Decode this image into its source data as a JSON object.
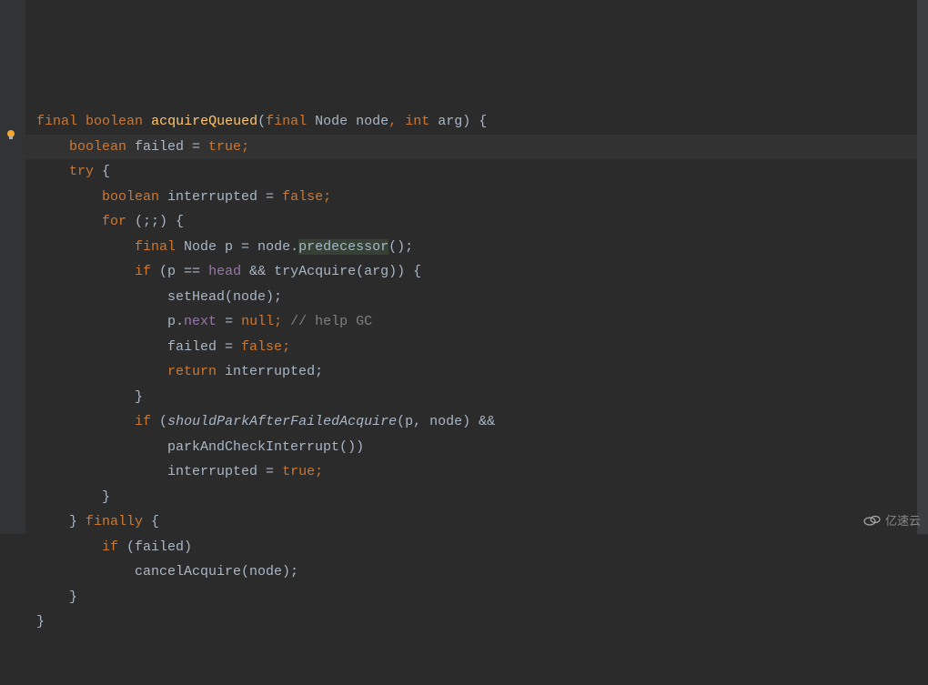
{
  "code": {
    "line1": {
      "kw_final": "final",
      "kw_boolean": "boolean",
      "method": "acquireQueued",
      "paren_open": "(",
      "kw_final2": "final",
      "type_node": "Node",
      "param_node": "node",
      "comma": ", ",
      "kw_int": "int",
      "param_arg": " arg",
      "paren_close": ") {"
    },
    "line2": {
      "kw_boolean": "boolean",
      "var": " failed = ",
      "kw_true": "true",
      "semi": ";"
    },
    "line3": {
      "kw_try": "try",
      "brace": " {"
    },
    "line4": {
      "kw_boolean": "boolean",
      "var": " interrupted = ",
      "kw_false": "false",
      "semi": ";"
    },
    "line5": {
      "kw_for": "for",
      "parens": " (;;) {"
    },
    "line6": {
      "kw_final": "final",
      "type": " Node p = node.",
      "predecessor": "predecessor",
      "end": "();"
    },
    "line7": {
      "kw_if": "if",
      "open": " (p == ",
      "head": "head",
      "and": " && tryAcquire(arg)) {"
    },
    "line8": {
      "text": "setHead(node);"
    },
    "line9": {
      "p_dot": "p.",
      "next": "next",
      "eq": " = ",
      "kw_null": "null",
      "semi": "; ",
      "comment": "// help GC"
    },
    "line10": {
      "var": "failed = ",
      "kw_false": "false",
      "semi": ";"
    },
    "line11": {
      "kw_return": "return",
      "var": " interrupted;"
    },
    "line12": {
      "brace": "}"
    },
    "line13": {
      "kw_if": "if",
      "open": " (",
      "method": "shouldParkAfterFailedAcquire",
      "args": "(p, node) &&"
    },
    "line14": {
      "text": "parkAndCheckInterrupt())"
    },
    "line15": {
      "var": "interrupted = ",
      "kw_true": "true",
      "semi": ";"
    },
    "line16": {
      "brace": "}"
    },
    "line17": {
      "brace": "} ",
      "kw_finally": "finally",
      "open": " {"
    },
    "line18": {
      "kw_if": "if",
      "cond": " (failed)"
    },
    "line19": {
      "text": "cancelAcquire(node);"
    },
    "line20": {
      "brace": "}"
    },
    "line21": {
      "brace": "}"
    }
  },
  "watermark": {
    "text": "亿速云"
  }
}
